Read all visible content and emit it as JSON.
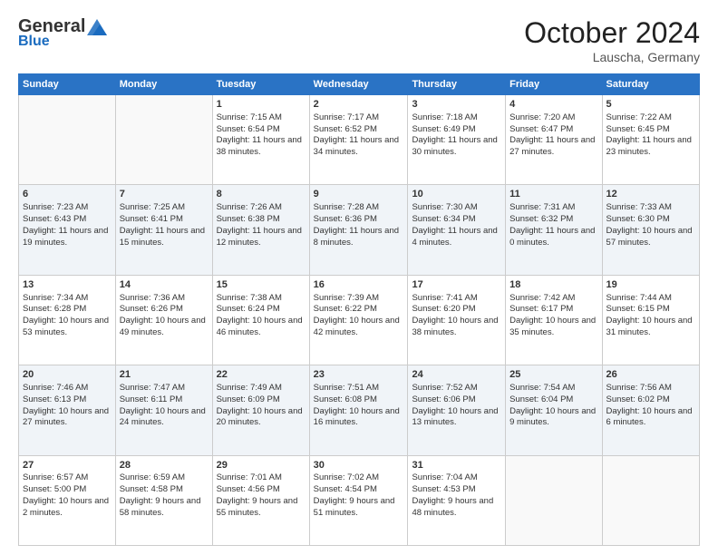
{
  "header": {
    "logo_general": "General",
    "logo_blue": "Blue",
    "month_title": "October 2024",
    "location": "Lauscha, Germany"
  },
  "weekdays": [
    "Sunday",
    "Monday",
    "Tuesday",
    "Wednesday",
    "Thursday",
    "Friday",
    "Saturday"
  ],
  "weeks": [
    [
      null,
      null,
      {
        "day": 1,
        "sunrise": "7:15 AM",
        "sunset": "6:54 PM",
        "daylight": "11 hours and 38 minutes."
      },
      {
        "day": 2,
        "sunrise": "7:17 AM",
        "sunset": "6:52 PM",
        "daylight": "11 hours and 34 minutes."
      },
      {
        "day": 3,
        "sunrise": "7:18 AM",
        "sunset": "6:49 PM",
        "daylight": "11 hours and 30 minutes."
      },
      {
        "day": 4,
        "sunrise": "7:20 AM",
        "sunset": "6:47 PM",
        "daylight": "11 hours and 27 minutes."
      },
      {
        "day": 5,
        "sunrise": "7:22 AM",
        "sunset": "6:45 PM",
        "daylight": "11 hours and 23 minutes."
      }
    ],
    [
      {
        "day": 6,
        "sunrise": "7:23 AM",
        "sunset": "6:43 PM",
        "daylight": "11 hours and 19 minutes."
      },
      {
        "day": 7,
        "sunrise": "7:25 AM",
        "sunset": "6:41 PM",
        "daylight": "11 hours and 15 minutes."
      },
      {
        "day": 8,
        "sunrise": "7:26 AM",
        "sunset": "6:38 PM",
        "daylight": "11 hours and 12 minutes."
      },
      {
        "day": 9,
        "sunrise": "7:28 AM",
        "sunset": "6:36 PM",
        "daylight": "11 hours and 8 minutes."
      },
      {
        "day": 10,
        "sunrise": "7:30 AM",
        "sunset": "6:34 PM",
        "daylight": "11 hours and 4 minutes."
      },
      {
        "day": 11,
        "sunrise": "7:31 AM",
        "sunset": "6:32 PM",
        "daylight": "11 hours and 0 minutes."
      },
      {
        "day": 12,
        "sunrise": "7:33 AM",
        "sunset": "6:30 PM",
        "daylight": "10 hours and 57 minutes."
      }
    ],
    [
      {
        "day": 13,
        "sunrise": "7:34 AM",
        "sunset": "6:28 PM",
        "daylight": "10 hours and 53 minutes."
      },
      {
        "day": 14,
        "sunrise": "7:36 AM",
        "sunset": "6:26 PM",
        "daylight": "10 hours and 49 minutes."
      },
      {
        "day": 15,
        "sunrise": "7:38 AM",
        "sunset": "6:24 PM",
        "daylight": "10 hours and 46 minutes."
      },
      {
        "day": 16,
        "sunrise": "7:39 AM",
        "sunset": "6:22 PM",
        "daylight": "10 hours and 42 minutes."
      },
      {
        "day": 17,
        "sunrise": "7:41 AM",
        "sunset": "6:20 PM",
        "daylight": "10 hours and 38 minutes."
      },
      {
        "day": 18,
        "sunrise": "7:42 AM",
        "sunset": "6:17 PM",
        "daylight": "10 hours and 35 minutes."
      },
      {
        "day": 19,
        "sunrise": "7:44 AM",
        "sunset": "6:15 PM",
        "daylight": "10 hours and 31 minutes."
      }
    ],
    [
      {
        "day": 20,
        "sunrise": "7:46 AM",
        "sunset": "6:13 PM",
        "daylight": "10 hours and 27 minutes."
      },
      {
        "day": 21,
        "sunrise": "7:47 AM",
        "sunset": "6:11 PM",
        "daylight": "10 hours and 24 minutes."
      },
      {
        "day": 22,
        "sunrise": "7:49 AM",
        "sunset": "6:09 PM",
        "daylight": "10 hours and 20 minutes."
      },
      {
        "day": 23,
        "sunrise": "7:51 AM",
        "sunset": "6:08 PM",
        "daylight": "10 hours and 16 minutes."
      },
      {
        "day": 24,
        "sunrise": "7:52 AM",
        "sunset": "6:06 PM",
        "daylight": "10 hours and 13 minutes."
      },
      {
        "day": 25,
        "sunrise": "7:54 AM",
        "sunset": "6:04 PM",
        "daylight": "10 hours and 9 minutes."
      },
      {
        "day": 26,
        "sunrise": "7:56 AM",
        "sunset": "6:02 PM",
        "daylight": "10 hours and 6 minutes."
      }
    ],
    [
      {
        "day": 27,
        "sunrise": "6:57 AM",
        "sunset": "5:00 PM",
        "daylight": "10 hours and 2 minutes."
      },
      {
        "day": 28,
        "sunrise": "6:59 AM",
        "sunset": "4:58 PM",
        "daylight": "9 hours and 58 minutes."
      },
      {
        "day": 29,
        "sunrise": "7:01 AM",
        "sunset": "4:56 PM",
        "daylight": "9 hours and 55 minutes."
      },
      {
        "day": 30,
        "sunrise": "7:02 AM",
        "sunset": "4:54 PM",
        "daylight": "9 hours and 51 minutes."
      },
      {
        "day": 31,
        "sunrise": "7:04 AM",
        "sunset": "4:53 PM",
        "daylight": "9 hours and 48 minutes."
      },
      null,
      null
    ]
  ]
}
